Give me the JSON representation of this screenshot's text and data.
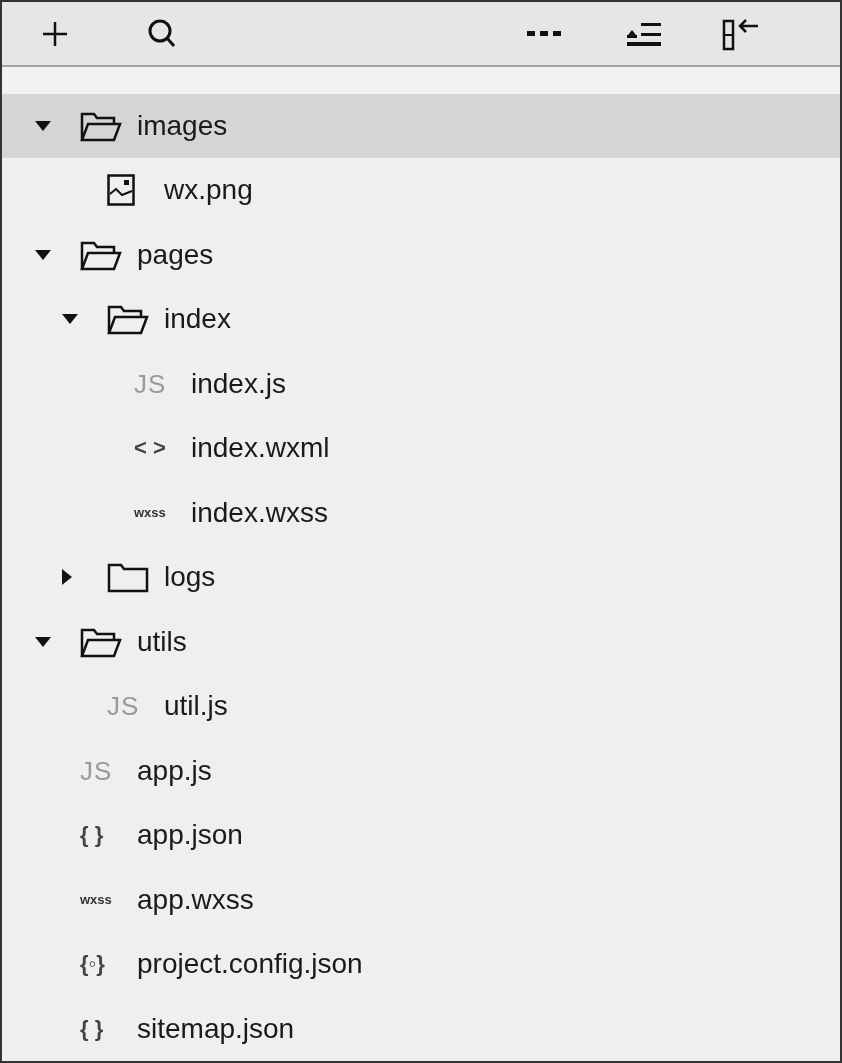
{
  "toolbar": {
    "buttons": [
      {
        "kind": "add"
      },
      {
        "kind": "search"
      },
      {
        "kind": "more"
      },
      {
        "kind": "collapse"
      },
      {
        "kind": "hide"
      }
    ]
  },
  "tree": [
    {
      "name": "images",
      "kind": "folder",
      "expanded": true,
      "selected": true,
      "children": [
        {
          "name": "wx.png",
          "kind": "image",
          "selected": false
        }
      ]
    },
    {
      "name": "pages",
      "kind": "folder",
      "expanded": true,
      "selected": false,
      "children": [
        {
          "name": "index",
          "kind": "folder",
          "expanded": true,
          "selected": false,
          "children": [
            {
              "name": "index.js",
              "kind": "js",
              "badge": "JS",
              "selected": false
            },
            {
              "name": "index.wxml",
              "kind": "code",
              "badge": "< >",
              "selected": false
            },
            {
              "name": "index.wxss",
              "kind": "style",
              "badge": "wxss",
              "selected": false
            }
          ]
        },
        {
          "name": "logs",
          "kind": "folder",
          "expanded": false,
          "selected": false
        }
      ]
    },
    {
      "name": "utils",
      "kind": "folder",
      "expanded": true,
      "selected": false,
      "children": [
        {
          "name": "util.js",
          "kind": "js",
          "badge": "JS",
          "selected": false
        }
      ]
    },
    {
      "name": "app.js",
      "kind": "js",
      "badge": "JS",
      "selected": false
    },
    {
      "name": "app.json",
      "kind": "code",
      "badge": "{ }",
      "selected": false
    },
    {
      "name": "app.wxss",
      "kind": "style",
      "badge": "wxss",
      "selected": false
    },
    {
      "name": "project.config.json",
      "kind": "code",
      "badge": "{◦}",
      "selected": false
    },
    {
      "name": "sitemap.json",
      "kind": "code",
      "badge": "{ }",
      "selected": false
    }
  ]
}
